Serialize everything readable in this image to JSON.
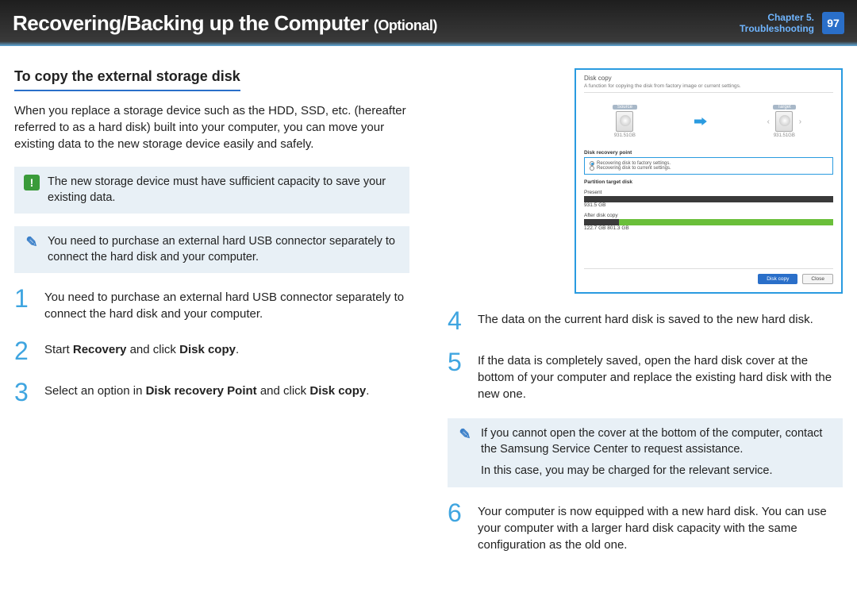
{
  "header": {
    "title_main": "Recovering/Backing up the Computer ",
    "title_opt": "(Optional)",
    "chapter_line1": "Chapter 5.",
    "chapter_line2": "Troubleshooting",
    "page_number": "97"
  },
  "left": {
    "section_title": "To copy the external storage disk",
    "intro": "When you replace a storage device such as the HDD, SSD, etc. (hereafter referred to as a hard disk) built into your computer, you can move your existing data to the new storage device easily and safely.",
    "callout_warning": "The new storage device must have sufficient capacity to save your existing data.",
    "callout_note": "You need to purchase an external hard USB connector separately to connect the hard disk and your computer.",
    "step1": "You need to purchase an external hard USB connector separately to connect the hard disk and your computer.",
    "step2_pre": "Start ",
    "step2_b1": "Recovery",
    "step2_mid": " and click ",
    "step2_b2": "Disk copy",
    "step2_post": ".",
    "step3_pre": "Select an option in ",
    "step3_b1": "Disk recovery Point",
    "step3_mid": " and click ",
    "step3_b2": "Disk copy",
    "step3_post": "."
  },
  "right": {
    "step4": "The data on the current hard disk is saved to the new hard disk.",
    "step5": "If the data is completely saved, open the hard disk cover at the bottom of your computer and replace the existing hard disk with the new one.",
    "callout_note_l1": "If you cannot open the cover at the bottom of the computer, contact the Samsung Service Center to request assistance.",
    "callout_note_l2": "In this case, you may be charged for the relevant service.",
    "step6": "Your computer is now equipped with a new hard disk. You can use your computer with a larger hard disk capacity with the same configuration as the old one."
  },
  "screenshot": {
    "title": "Disk copy",
    "subtitle": "A function for copying the disk from factory image or current settings.",
    "source_label": "Source",
    "target_label": "Target",
    "size": "931.51GB",
    "recovery_section": "Disk recovery point",
    "opt1": "Recovering disk to factory settings.",
    "opt2": "Recovering disk to current settings.",
    "partition_section": "Partition target disk",
    "present_label": "Present",
    "present_size": "931.5 GB",
    "after_label": "After disk copy",
    "after_sizes": "122.7 GB    801.3 GB",
    "btn_primary": "Disk copy",
    "btn_close": "Close"
  }
}
